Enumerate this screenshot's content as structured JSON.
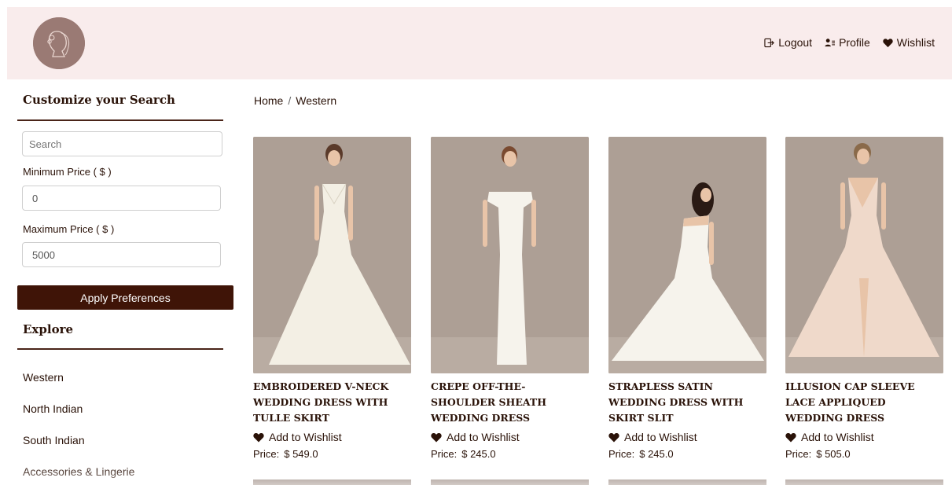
{
  "header": {
    "nav": {
      "logout": "Logout",
      "profile": "Profile",
      "wishlist": "Wishlist"
    }
  },
  "sidebar": {
    "customize_title": "Customize your Search",
    "search_placeholder": "Search",
    "min_label": "Minimum Price ( $ )",
    "min_value": "0",
    "max_label": "Maximum Price ( $ )",
    "max_value": "5000",
    "apply_label": "Apply Preferences",
    "explore_title": "Explore",
    "explore_items": [
      "Western",
      "North Indian",
      "South Indian",
      "Accessories & Lingerie"
    ]
  },
  "breadcrumb": {
    "home": "Home",
    "separator": "/",
    "current": "Western"
  },
  "products": [
    {
      "name": "EMBROIDERED V-NECK WEDDING DRESS WITH TULLE SKIRT",
      "wish_label": "Add to Wishlist",
      "price_label": "Price:",
      "price": "$ 549.0"
    },
    {
      "name": "CREPE OFF-THE-SHOULDER SHEATH WEDDING DRESS",
      "wish_label": "Add to Wishlist",
      "price_label": "Price:",
      "price": "$ 245.0"
    },
    {
      "name": "STRAPLESS SATIN WEDDING DRESS WITH SKIRT SLIT",
      "wish_label": "Add to Wishlist",
      "price_label": "Price:",
      "price": "$ 245.0"
    },
    {
      "name": "ILLUSION CAP SLEEVE LACE APPLIQUED WEDDING DRESS",
      "wish_label": "Add to Wishlist",
      "price_label": "Price:",
      "price": "$ 505.0"
    }
  ],
  "icons": {
    "logo": "bride-silhouette-logo",
    "logout": "logout-icon",
    "profile": "profile-icon",
    "wishlist": "heart-icon"
  },
  "colors": {
    "header_bg": "#f9ecec",
    "accent": "#3f1407",
    "text": "#2a1208",
    "image_bg": "#ad9f95"
  }
}
